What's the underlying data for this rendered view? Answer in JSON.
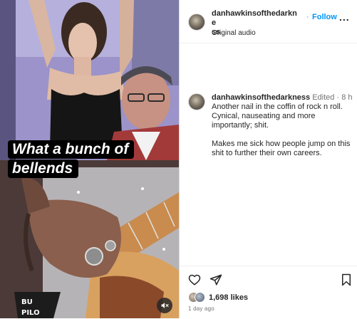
{
  "media": {
    "caption_line1": "What a bunch of",
    "caption_line2": "bellends",
    "mute_icon": "speaker-muted-icon"
  },
  "header": {
    "username_line1": "danhawkinsofthedarkne",
    "username_line2": "ss",
    "separator": "·",
    "follow_label": "Follow",
    "audio_label": "Original audio",
    "more_label": "..."
  },
  "comment": {
    "username": "danhawkinsofthedarkness",
    "edited_label": "Edited",
    "separator": "·",
    "time": "8 h",
    "paragraph1": "Another nail in the coffin of rock n roll. Cynical, nauseating and more importantly; shit.",
    "paragraph2": "Makes me sick how people jump on this shit to further their own careers."
  },
  "actions": {
    "like_icon": "heart-icon",
    "share_icon": "share-icon",
    "save_icon": "bookmark-icon",
    "likes_text": "1,698 likes",
    "date_text": "1 day ago"
  },
  "colors": {
    "accent": "#0095f6",
    "text": "#262626",
    "muted": "#737373",
    "divider": "#dbdbdb"
  }
}
